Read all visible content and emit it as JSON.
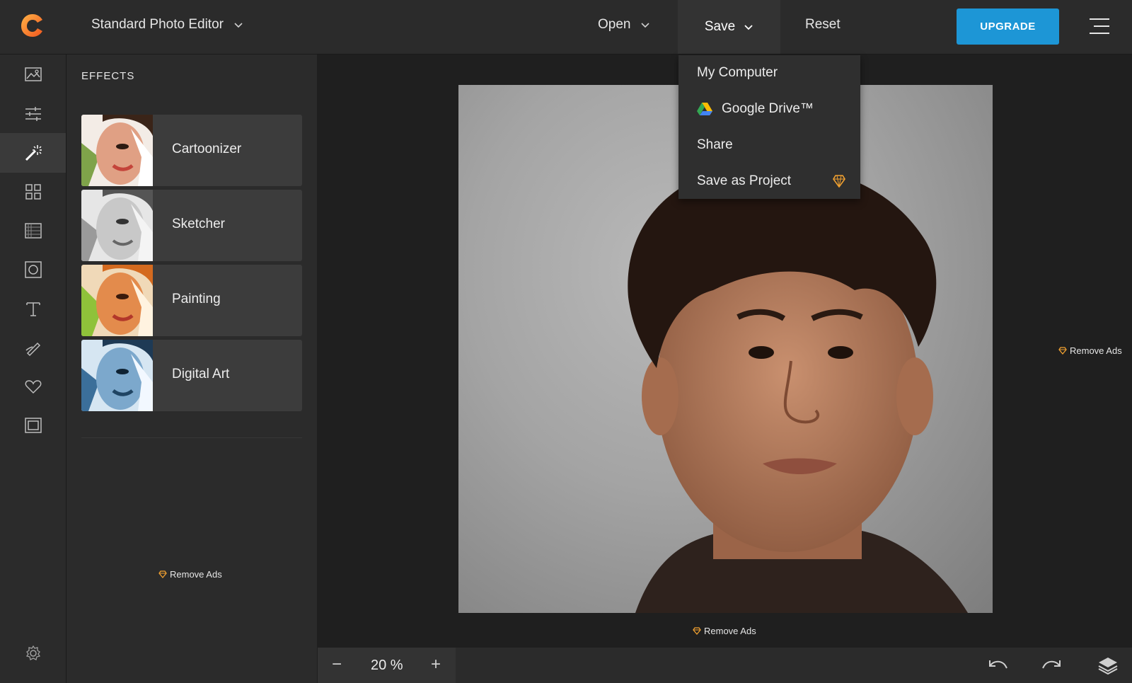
{
  "app": {
    "editor_mode": "Standard Photo Editor"
  },
  "topbar": {
    "open_label": "Open",
    "save_label": "Save",
    "reset_label": "Reset",
    "upgrade_label": "UPGRADE",
    "upgrade_color": "#1d96d6"
  },
  "save_menu": {
    "items": [
      {
        "label": "My Computer"
      },
      {
        "label": "Google Drive™",
        "icon": "google-drive-icon"
      },
      {
        "label": "Share"
      },
      {
        "label": "Save as Project",
        "badge_icon": "diamond-pro-icon"
      }
    ]
  },
  "toolrail": {
    "tools": [
      "image-icon",
      "adjust-sliders-icon",
      "magic-wand-icon",
      "grid-icon",
      "texture-icon",
      "frame-icon",
      "text-icon",
      "brush-icon",
      "heart-icon",
      "border-icon"
    ],
    "active_tool": "magic-wand-icon",
    "settings_icon": "gear-icon"
  },
  "effects_panel": {
    "title": "EFFECTS",
    "effects": [
      {
        "label": "Cartoonizer"
      },
      {
        "label": "Sketcher"
      },
      {
        "label": "Painting"
      },
      {
        "label": "Digital Art"
      }
    ],
    "remove_ads": "Remove Ads"
  },
  "canvas": {
    "remove_ads_right": "Remove Ads",
    "remove_ads_bottom": "Remove Ads"
  },
  "bottombar": {
    "zoom_minus": "−",
    "zoom_value": "20 %",
    "zoom_plus": "+"
  }
}
